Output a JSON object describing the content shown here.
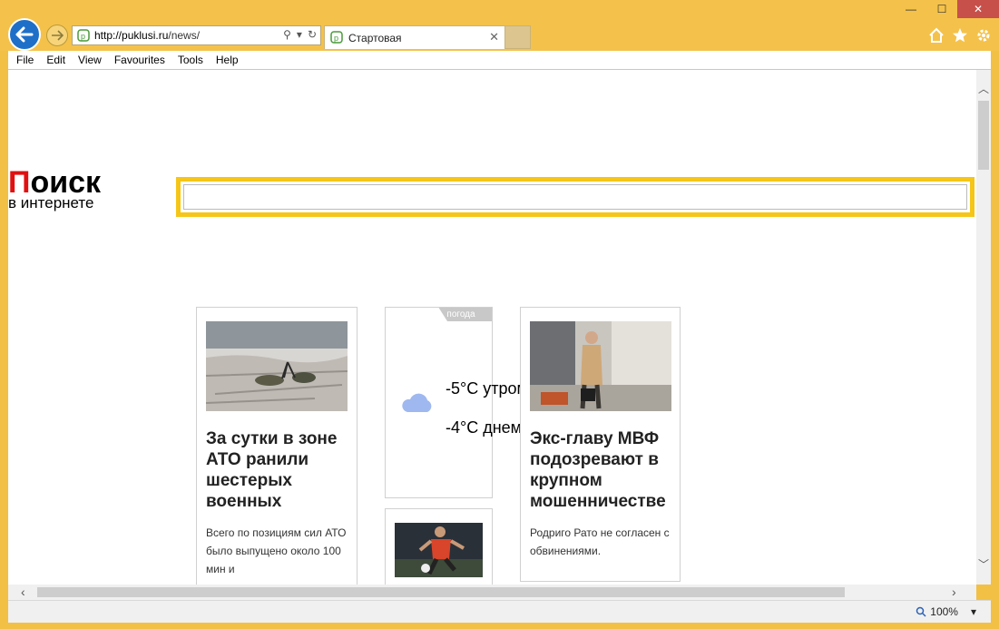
{
  "browser": {
    "address": {
      "host": "http://puklusi.ru",
      "path": "/news/"
    },
    "tab": {
      "title": "Стартовая"
    },
    "menu": [
      "File",
      "Edit",
      "View",
      "Favourites",
      "Tools",
      "Help"
    ],
    "zoom": "100%"
  },
  "page": {
    "logo": {
      "big_first": "П",
      "big_rest": "оиск",
      "small": "в интернете"
    },
    "cards": [
      {
        "title": "За сутки в зоне АТО ранили шестерых военных",
        "desc": "Всего по позициям сил АТО было выпущено около 100 мин и"
      },
      {
        "title": "Экс-главу МВФ подозревают в крупном мошенничестве",
        "desc": "Родриго Рато не согласен с обвинениями."
      }
    ],
    "weather": {
      "tag": "погода",
      "morning": "-5°C утром",
      "day": "-4°C днем"
    }
  },
  "colors": {
    "accent_search": "#f5c518",
    "logo_red": "#e01010",
    "chrome": "#f4c24a"
  }
}
